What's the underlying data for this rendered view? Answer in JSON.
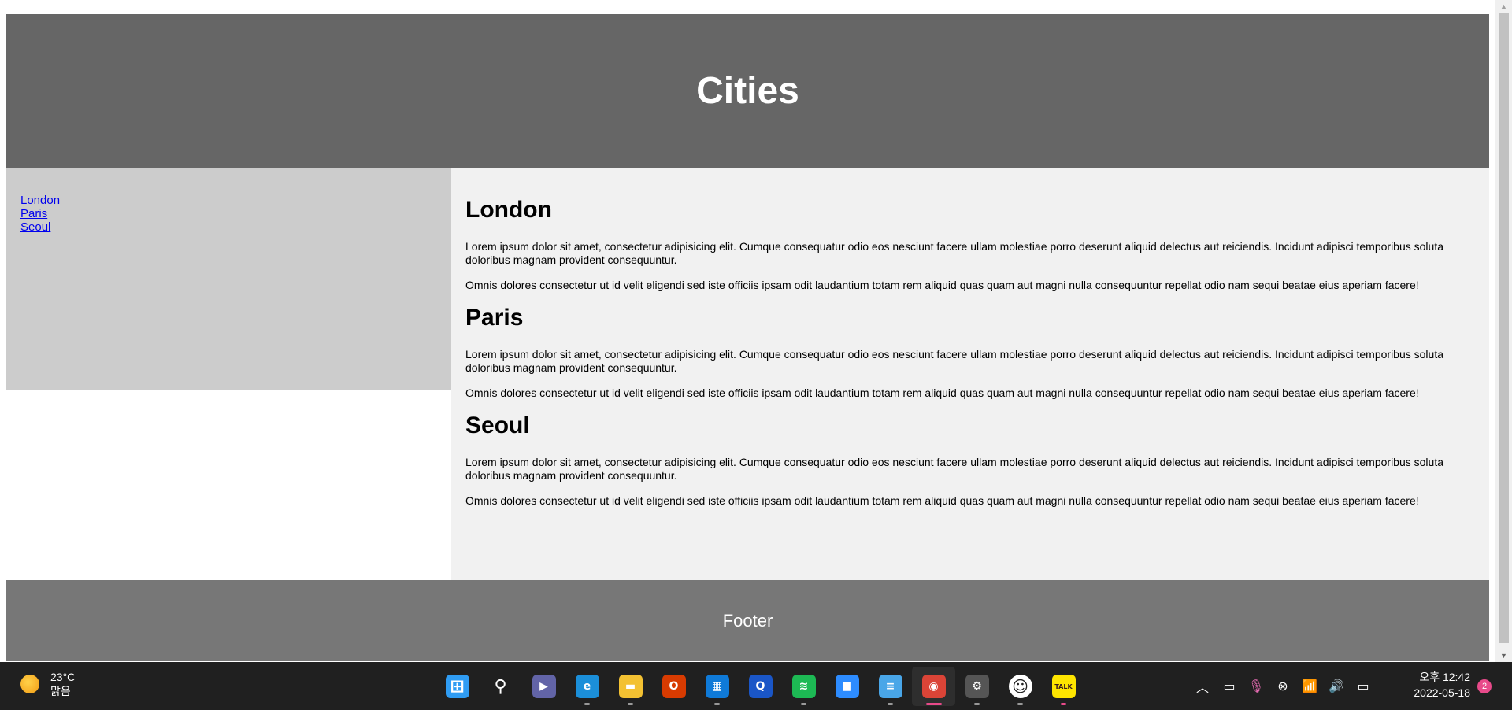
{
  "page": {
    "header_title": "Cities",
    "nav_links": [
      "London",
      "Paris",
      "Seoul"
    ],
    "sections": [
      {
        "title": "London",
        "paragraphs": [
          "Lorem ipsum dolor sit amet, consectetur adipisicing elit. Cumque consequatur odio eos nesciunt facere ullam molestiae porro deserunt aliquid delectus aut reiciendis. Incidunt adipisci temporibus soluta doloribus magnam provident consequuntur.",
          "Omnis dolores consectetur ut id velit eligendi sed iste officiis ipsam odit laudantium totam rem aliquid quas quam aut magni nulla consequuntur repellat odio nam sequi beatae eius aperiam facere!"
        ]
      },
      {
        "title": "Paris",
        "paragraphs": [
          "Lorem ipsum dolor sit amet, consectetur adipisicing elit. Cumque consequatur odio eos nesciunt facere ullam molestiae porro deserunt aliquid delectus aut reiciendis. Incidunt adipisci temporibus soluta doloribus magnam provident consequuntur.",
          "Omnis dolores consectetur ut id velit eligendi sed iste officiis ipsam odit laudantium totam rem aliquid quas quam aut magni nulla consequuntur repellat odio nam sequi beatae eius aperiam facere!"
        ]
      },
      {
        "title": "Seoul",
        "paragraphs": [
          "Lorem ipsum dolor sit amet, consectetur adipisicing elit. Cumque consequatur odio eos nesciunt facere ullam molestiae porro deserunt aliquid delectus aut reiciendis. Incidunt adipisci temporibus soluta doloribus magnam provident consequuntur.",
          "Omnis dolores consectetur ut id velit eligendi sed iste officiis ipsam odit laudantium totam rem aliquid quas quam aut magni nulla consequuntur repellat odio nam sequi beatae eius aperiam facere!"
        ]
      }
    ],
    "footer_text": "Footer"
  },
  "taskbar": {
    "weather": {
      "temp": "23°C",
      "condition": "맑음",
      "icon": "sun-icon"
    },
    "apps": [
      {
        "name": "start",
        "icon": "windows-start-icon",
        "color": "#2f9cf3",
        "glyph": "⊞"
      },
      {
        "name": "search",
        "icon": "search-icon",
        "color": "transparent",
        "glyph": "⚲"
      },
      {
        "name": "chat",
        "icon": "teams-chat-icon",
        "color": "#6264a7",
        "glyph": "▶"
      },
      {
        "name": "edge",
        "icon": "edge-icon",
        "color": "#1b8fd9",
        "glyph": "e"
      },
      {
        "name": "file-explorer",
        "icon": "folder-icon",
        "color": "#f3c132",
        "glyph": "▬"
      },
      {
        "name": "office",
        "icon": "office-icon",
        "color": "#d83b01",
        "glyph": "O"
      },
      {
        "name": "store",
        "icon": "store-icon",
        "color": "#0f7ad8",
        "glyph": "▦"
      },
      {
        "name": "dictionary",
        "icon": "dictionary-icon",
        "color": "#1a56c7",
        "glyph": "Q"
      },
      {
        "name": "spotify",
        "icon": "spotify-icon",
        "color": "#1db954",
        "glyph": "≋"
      },
      {
        "name": "zoom",
        "icon": "zoom-icon",
        "color": "#2d8cff",
        "glyph": "■"
      },
      {
        "name": "notepad",
        "icon": "notepad-icon",
        "color": "#49a6e8",
        "glyph": "≡"
      },
      {
        "name": "chrome",
        "icon": "chrome-icon",
        "color": "#db4437",
        "glyph": "◉"
      },
      {
        "name": "settings",
        "icon": "gear-icon",
        "color": "#555555",
        "glyph": "⚙"
      },
      {
        "name": "emoji-app",
        "icon": "smiley-icon",
        "color": "#ffffff",
        "glyph": "☺"
      },
      {
        "name": "kakaotalk",
        "icon": "kakaotalk-icon",
        "color": "#fee500",
        "glyph": "TALK"
      }
    ],
    "tray": [
      {
        "icon": "chevron-up-icon",
        "glyph": "︿"
      },
      {
        "icon": "tablet-icon",
        "glyph": "▭"
      },
      {
        "icon": "microphone-icon",
        "glyph": "🎙"
      },
      {
        "icon": "close-circle-icon",
        "glyph": "⊗"
      },
      {
        "icon": "wifi-icon",
        "glyph": "📶"
      },
      {
        "icon": "volume-icon",
        "glyph": "🔊"
      },
      {
        "icon": "battery-icon",
        "glyph": "▭"
      }
    ],
    "clock": {
      "time": "오후 12:42",
      "date": "2022-05-18"
    },
    "notification_count": "2"
  }
}
